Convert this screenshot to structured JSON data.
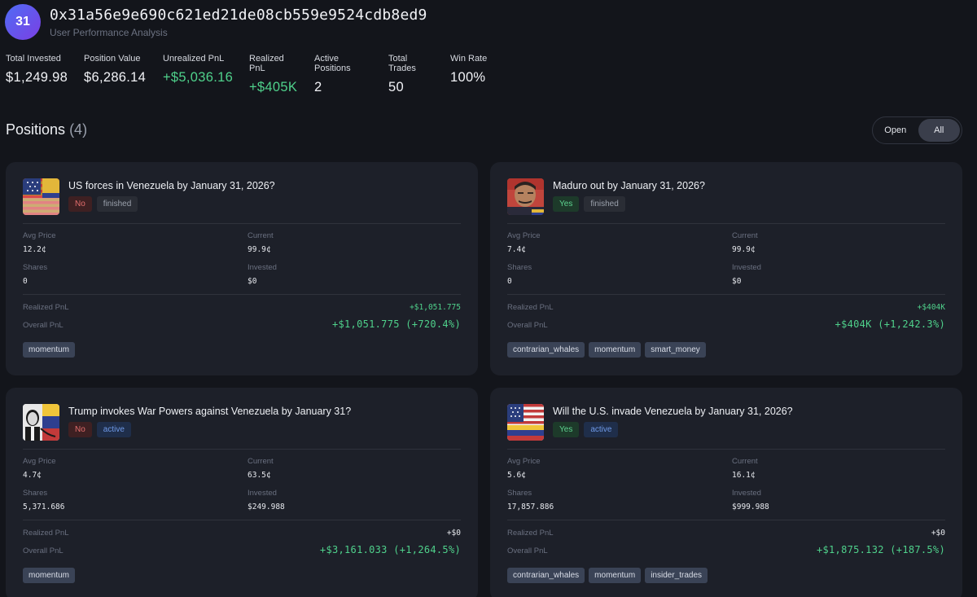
{
  "user": {
    "avatar_text": "31",
    "address": "0x31a56e9e690c621ed21de08cb559e9524cdb8ed9",
    "subtitle": "User Performance Analysis"
  },
  "stats": [
    {
      "label": "Total Invested",
      "value": "$1,249.98"
    },
    {
      "label": "Position Value",
      "value": "$6,286.14"
    },
    {
      "label": "Unrealized PnL",
      "value": "+$5,036.16"
    },
    {
      "label": "Realized PnL",
      "value": "+$405K"
    },
    {
      "label": "Active Positions",
      "value": "2"
    },
    {
      "label": "Total Trades",
      "value": "50"
    },
    {
      "label": "Win Rate",
      "value": "100%"
    }
  ],
  "positions_header": {
    "title": "Positions",
    "count": "(4)"
  },
  "filter": {
    "open_label": "Open",
    "all_label": "All",
    "selected": "All"
  },
  "labels": {
    "avg_price": "Avg Price",
    "current": "Current",
    "shares": "Shares",
    "invested": "Invested",
    "realized_pnl": "Realized PnL",
    "overall_pnl": "Overall PnL"
  },
  "positions": [
    {
      "title": "US forces in Venezuela by January 31, 2026?",
      "outcome": "No",
      "status": "finished",
      "thumbnail": "us-venezuela-flag",
      "avg_price": "12.2¢",
      "current": "99.9¢",
      "shares": "0",
      "invested": "$0",
      "realized_pnl": "+$1,051.775",
      "overall_pnl": "+$1,051.775 (+720.4%)",
      "tags": [
        "momentum"
      ]
    },
    {
      "title": "Maduro out by January 31, 2026?",
      "outcome": "Yes",
      "status": "finished",
      "thumbnail": "maduro-portrait",
      "avg_price": "7.4¢",
      "current": "99.9¢",
      "shares": "0",
      "invested": "$0",
      "realized_pnl": "+$404K",
      "overall_pnl": "+$404K (+1,242.3%)",
      "tags": [
        "contrarian_whales",
        "momentum",
        "smart_money"
      ]
    },
    {
      "title": "Trump invokes War Powers against Venezuela by January 31?",
      "outcome": "No",
      "status": "active",
      "thumbnail": "trump-venezuela-flag",
      "avg_price": "4.7¢",
      "current": "63.5¢",
      "shares": "5,371.686",
      "invested": "$249.988",
      "realized_pnl": "+$0",
      "overall_pnl": "+$3,161.033 (+1,264.5%)",
      "tags": [
        "momentum"
      ]
    },
    {
      "title": "Will the U.S. invade Venezuela by January 31, 2026?",
      "outcome": "Yes",
      "status": "active",
      "thumbnail": "us-venezuela-split-flag",
      "avg_price": "5.6¢",
      "current": "16.1¢",
      "shares": "17,857.886",
      "invested": "$999.988",
      "realized_pnl": "+$0",
      "overall_pnl": "+$1,875.132 (+187.5%)",
      "tags": [
        "contrarian_whales",
        "momentum",
        "insider_trades"
      ]
    }
  ],
  "colors": {
    "background": "#13151b",
    "card": "#1d2029",
    "positive": "#4fd18b",
    "negative": "#e26d6d",
    "active_badge": "#6f9ae8"
  }
}
